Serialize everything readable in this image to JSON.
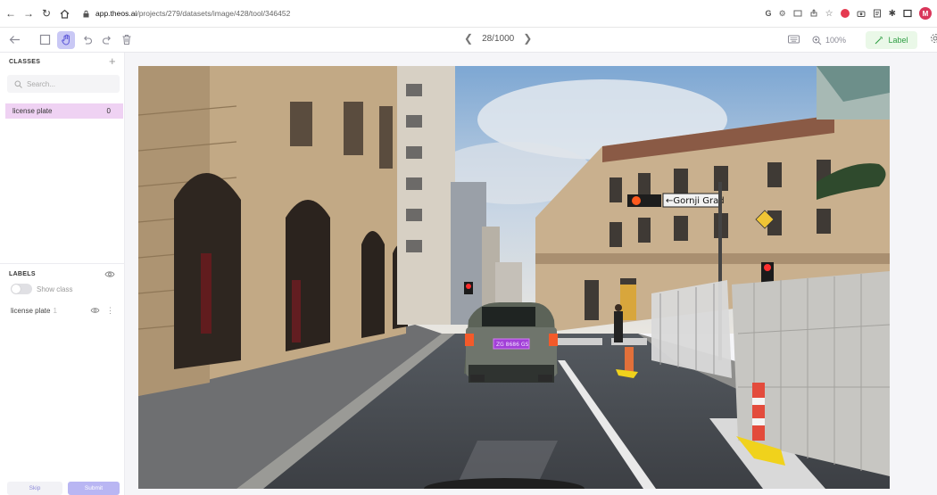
{
  "browser": {
    "url_host": "app.theos.ai",
    "url_path": "/projects/279/datasets/image/428/tool/346452",
    "profile_initial": "M"
  },
  "toolbar": {
    "pager": "28/1000",
    "zoom": "100%",
    "label_button": "Label"
  },
  "sidebar": {
    "classes_title": "CLASSES",
    "search_placeholder": "Search...",
    "classes": [
      {
        "name": "license plate",
        "count": "0",
        "color": "#efd2f3"
      }
    ],
    "labels_title": "LABELS",
    "show_class_label": "Show class",
    "labels": [
      {
        "name": "license plate",
        "index": "1"
      }
    ],
    "skip_label": "Skip",
    "submit_label": "Submit"
  },
  "scene": {
    "street_sign": "←Gornji Grad",
    "plate_text": "ZG 8686 GS"
  },
  "colors": {
    "accent": "#5b56d8",
    "active_tool_bg": "#c9c8f5",
    "label_green": "#2f9e44",
    "submit_bg": "#b9b6f3"
  }
}
